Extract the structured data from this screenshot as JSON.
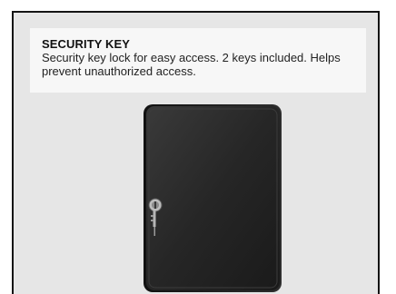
{
  "info": {
    "title": "SECURITY KEY",
    "description": "Security key lock for easy access. 2 keys included. Helps prevent unauthorized access."
  },
  "product_image": {
    "icon": "key-lock-box-icon",
    "colors": {
      "body": "#2b2b2b",
      "background": "#e6e6e6",
      "card": "#f7f7f7"
    }
  }
}
